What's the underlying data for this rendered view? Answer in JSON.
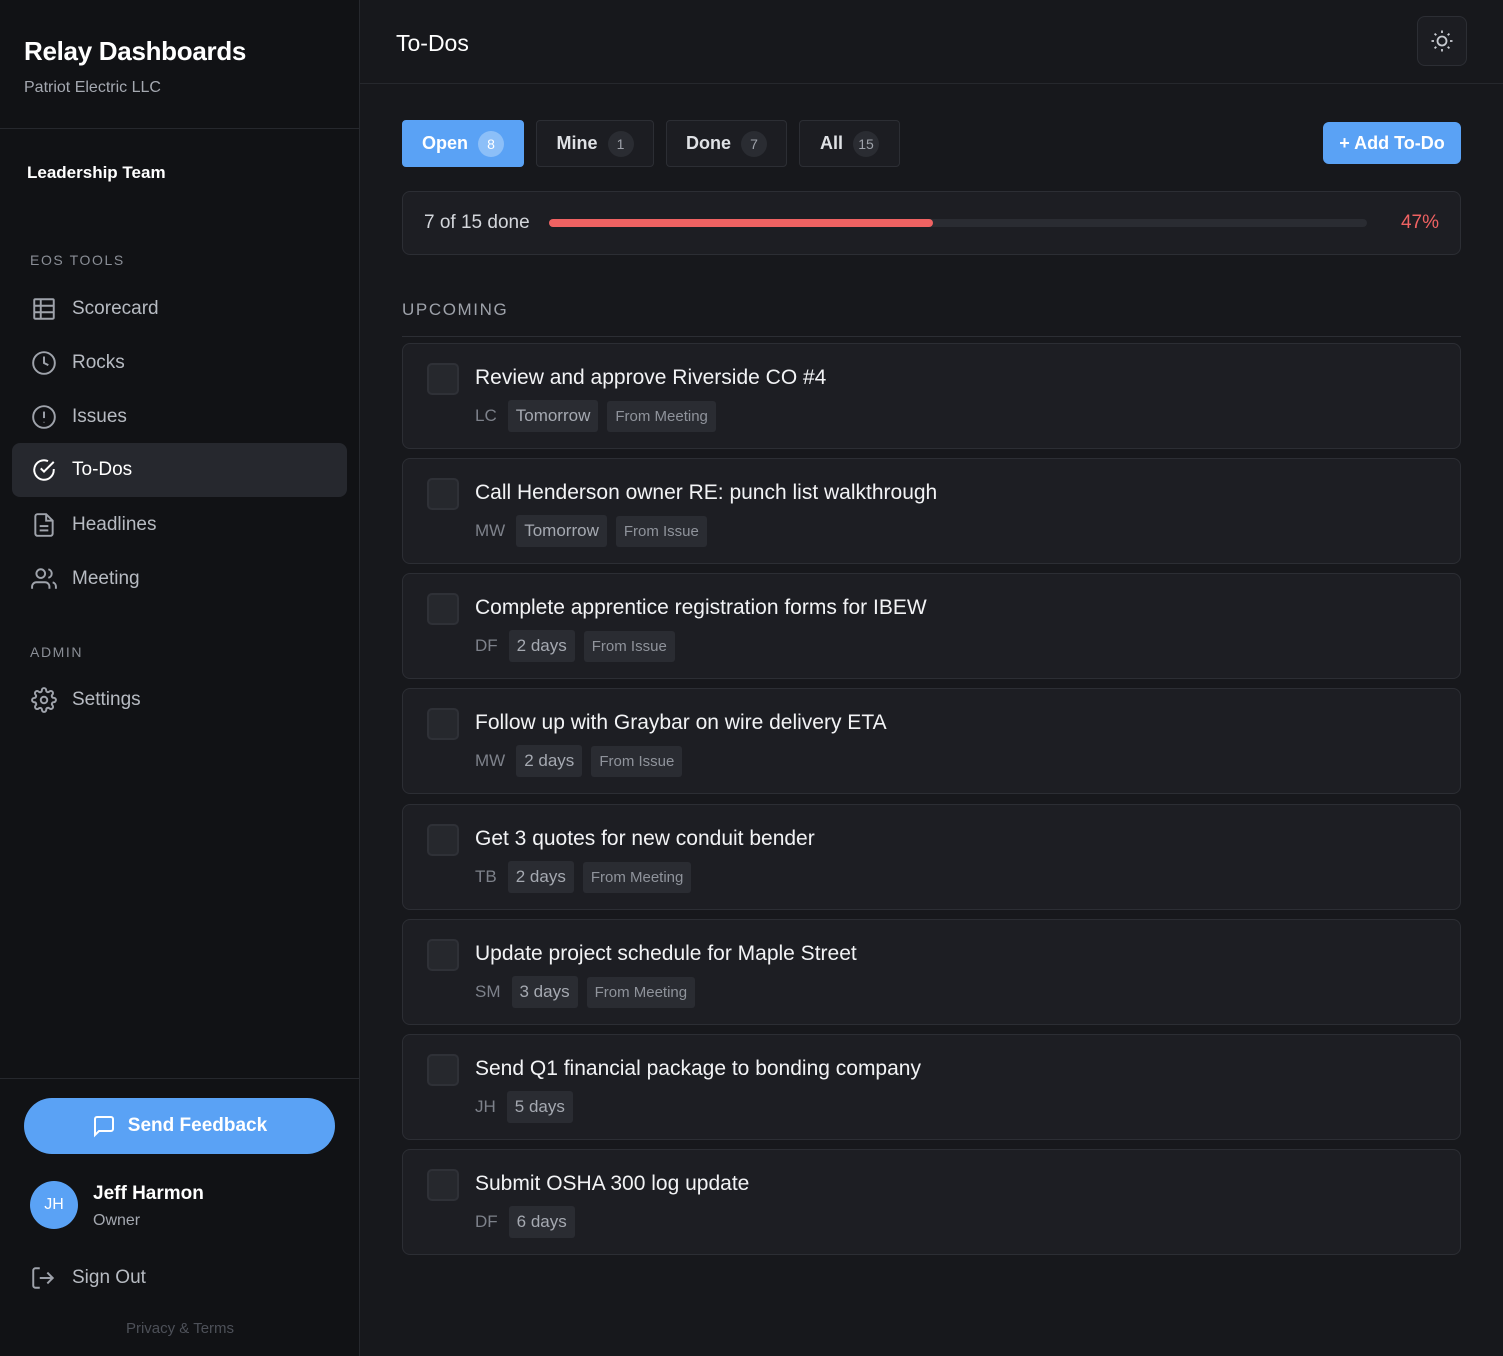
{
  "app": {
    "title": "Relay Dashboards",
    "company": "Patriot Electric LLC"
  },
  "team": "Leadership Team",
  "sidebar": {
    "section_tools": "EOS TOOLS",
    "section_admin": "ADMIN",
    "items": [
      {
        "label": "Scorecard",
        "icon": "grid-icon"
      },
      {
        "label": "Rocks",
        "icon": "clock-icon"
      },
      {
        "label": "Issues",
        "icon": "alert-circle-icon"
      },
      {
        "label": "To-Dos",
        "icon": "check-circle-icon",
        "active": true
      },
      {
        "label": "Headlines",
        "icon": "document-icon"
      },
      {
        "label": "Meeting",
        "icon": "users-icon"
      },
      {
        "label": "Settings",
        "icon": "gear-icon"
      }
    ],
    "feedback_label": "Send Feedback",
    "user": {
      "initials": "JH",
      "name": "Jeff Harmon",
      "role": "Owner"
    },
    "signout_label": "Sign Out",
    "privacy_label": "Privacy & Terms"
  },
  "header": {
    "title": "To-Dos",
    "theme_toggle_icon": "sun-icon"
  },
  "tabs": [
    {
      "label": "Open",
      "count": "8",
      "active": true
    },
    {
      "label": "Mine",
      "count": "1"
    },
    {
      "label": "Done",
      "count": "7"
    },
    {
      "label": "All",
      "count": "15"
    }
  ],
  "add_button": "+ Add To-Do",
  "progress": {
    "text": "7 of 15 done",
    "fraction": 0.47,
    "percent_label": "47%"
  },
  "upcoming_label": "UPCOMING",
  "todos": [
    {
      "title": "Review and approve Riverside CO #4",
      "owner": "LC",
      "due": "Tomorrow",
      "source": "From Meeting"
    },
    {
      "title": "Call Henderson owner RE: punch list walkthrough",
      "owner": "MW",
      "due": "Tomorrow",
      "source": "From Issue"
    },
    {
      "title": "Complete apprentice registration forms for IBEW",
      "owner": "DF",
      "due": "2 days",
      "source": "From Issue"
    },
    {
      "title": "Follow up with Graybar on wire delivery ETA",
      "owner": "MW",
      "due": "2 days",
      "source": "From Issue"
    },
    {
      "title": "Get 3 quotes for new conduit bender",
      "owner": "TB",
      "due": "2 days",
      "source": "From Meeting"
    },
    {
      "title": "Update project schedule for Maple Street",
      "owner": "SM",
      "due": "3 days",
      "source": "From Meeting"
    },
    {
      "title": "Send Q1 financial package to bonding company",
      "owner": "JH",
      "due": "5 days",
      "source": ""
    },
    {
      "title": "Submit OSHA 300 log update",
      "owner": "DF",
      "due": "6 days",
      "source": ""
    }
  ],
  "colors": {
    "accent": "#5aa2f5",
    "progress": "#ef6262",
    "background": "#17181c",
    "sidebar": "#111215"
  }
}
